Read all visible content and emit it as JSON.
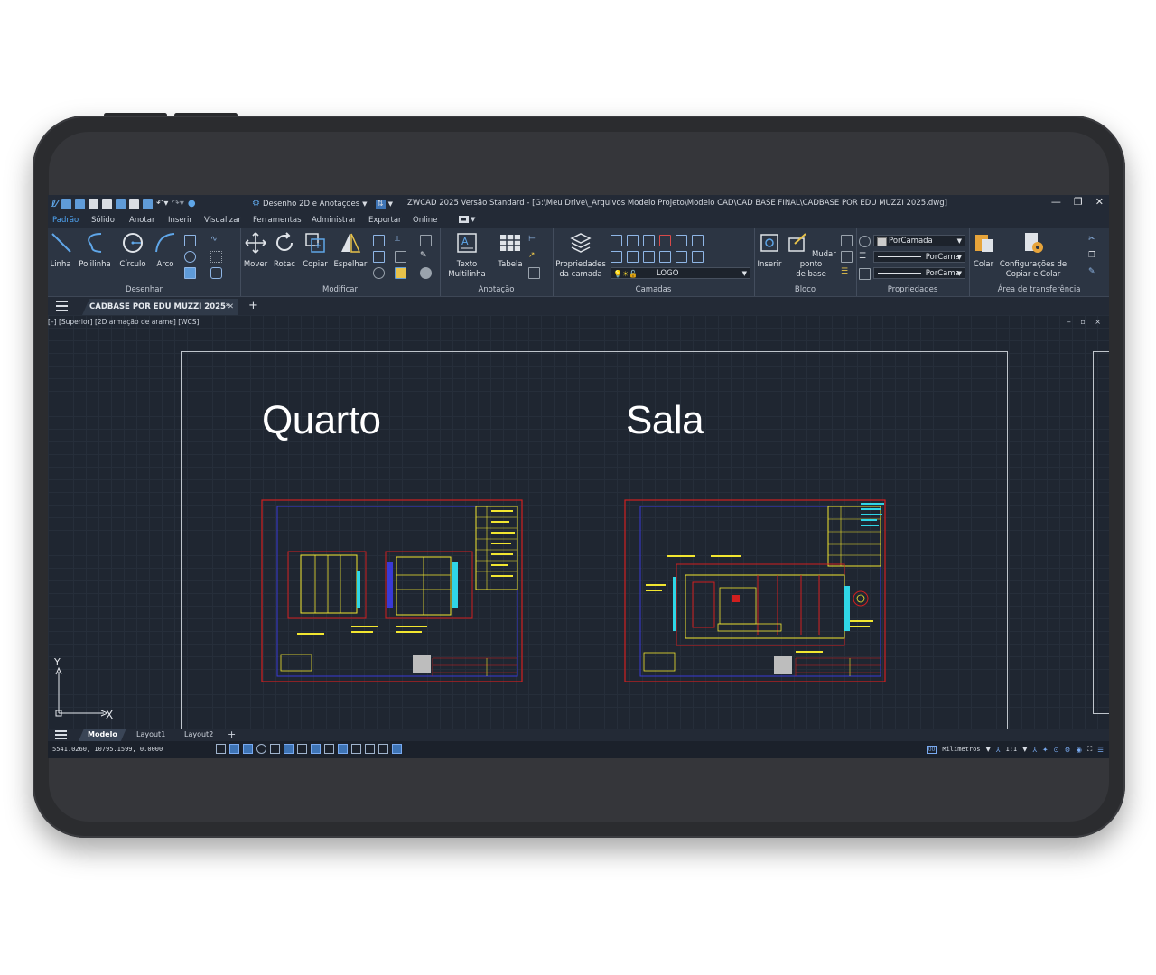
{
  "titlebar": {
    "workspace": "Desenho 2D e Anotações",
    "title": "ZWCAD 2025 Versão Standard - [G:\\Meu Drive\\_Arquivos Modelo Projeto\\Modelo CAD\\CAD BASE FINAL\\CADBASE POR EDU MUZZI 2025.dwg]",
    "minimize": "—",
    "restore": "❐",
    "close": "✕"
  },
  "menu": {
    "tabs": [
      "Padrão",
      "Sólido",
      "Anotar",
      "Inserir",
      "Visualizar",
      "Ferramentas",
      "Administrar",
      "Exportar",
      "Online"
    ],
    "active": "Padrão"
  },
  "ribbon": {
    "desenhar": {
      "title": "Desenhar",
      "tools": [
        "Linha",
        "Polilinha",
        "Círculo",
        "Arco"
      ]
    },
    "modificar": {
      "title": "Modificar",
      "tools": [
        "Mover",
        "Rotac",
        "Copiar",
        "Espelhar"
      ]
    },
    "anotacao": {
      "title": "Anotação",
      "texto_line1": "Texto",
      "texto_line2": "Multilinha",
      "tabela": "Tabela"
    },
    "camadas": {
      "title": "Camadas",
      "prop_line1": "Propriedades",
      "prop_line2": "da camada",
      "layer_value": "LOGO"
    },
    "bloco": {
      "title": "Bloco",
      "inserir": "Inserir",
      "mudar_line1": "Mudar ponto",
      "mudar_line2": "de base"
    },
    "propriedades": {
      "title": "Propriedades",
      "color": "PorCamada",
      "linetype": "PorCama",
      "lineweight": "PorCama"
    },
    "transferencia": {
      "title": "Área de transferência",
      "colar": "Colar",
      "config_line1": "Configurações de",
      "config_line2": "Copiar e Colar"
    }
  },
  "document": {
    "tab": "CADBASE POR EDU MUZZI 2025*",
    "close": "✕",
    "add": "+"
  },
  "viewport": {
    "label": "[–] [Superior] [2D armação de arame] [WCS]",
    "controls": "– ▫ ×",
    "label_quarto": "Quarto",
    "label_sala": "Sala",
    "axis_x": "X",
    "axis_y": "Y"
  },
  "layouts": {
    "tabs": [
      "Modelo",
      "Layout1",
      "Layout2"
    ],
    "add": "+"
  },
  "status": {
    "coords": "5541.0260, 10795.1599, 0.0000",
    "units": "Milímetros",
    "scale": "1:1"
  },
  "colors": {
    "accent": "#4ea3f2",
    "drawing_red": "#d11f1f",
    "drawing_yellow": "#f2e630",
    "drawing_blue": "#3a3ad6",
    "drawing_cyan": "#2fd6e6"
  }
}
